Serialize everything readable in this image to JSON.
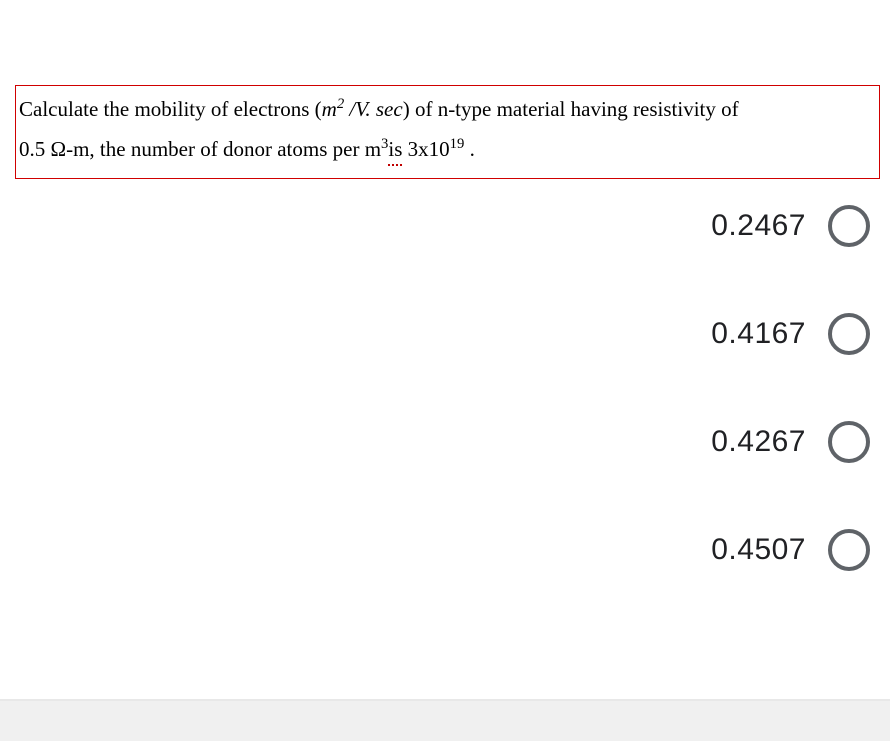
{
  "question": {
    "part1": "Calculate the mobility of electrons (",
    "unit_m": "m",
    "unit_exp1": "2",
    "unit_slash": " /",
    "unit_v": "V. sec",
    "part2": ") of n-type material having resistivity of",
    "line2a": "0.5 Ω-m, the number of donor atoms per m",
    "cube_exp": "3",
    "is_word": "  is ",
    "val_prefix": " 3x10",
    "val_exp": "19",
    "period": "  ."
  },
  "options": [
    {
      "label": "0.2467"
    },
    {
      "label": "0.4167"
    },
    {
      "label": "0.4267"
    },
    {
      "label": "0.4507"
    }
  ]
}
